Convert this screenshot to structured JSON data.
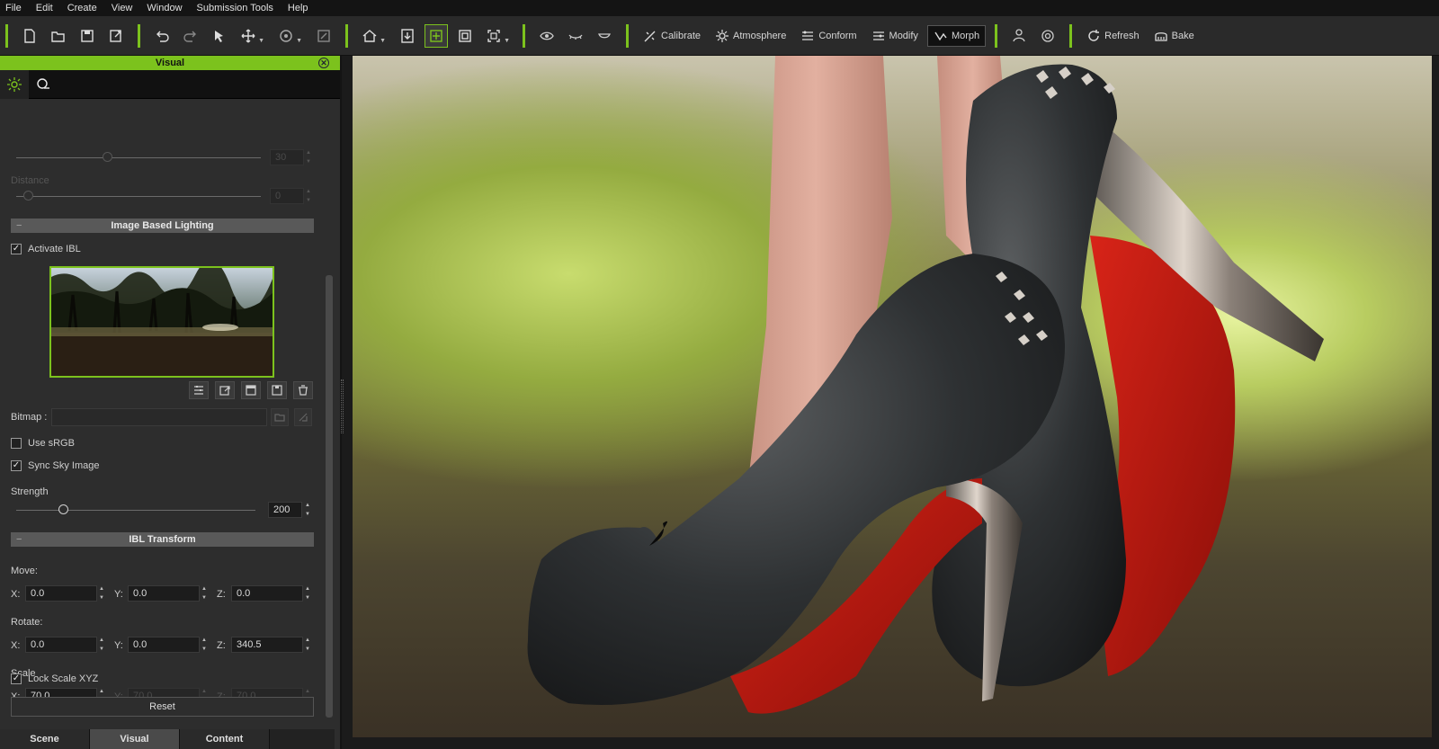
{
  "menu": [
    "File",
    "Edit",
    "Create",
    "View",
    "Window",
    "Submission Tools",
    "Help"
  ],
  "toolbar": {
    "calibrate": "Calibrate",
    "atmosphere": "Atmosphere",
    "conform": "Conform",
    "modify": "Modify",
    "morph": "Morph",
    "refresh": "Refresh",
    "bake": "Bake"
  },
  "panel": {
    "title": "Visual",
    "prev_value": "30",
    "distance_label": "Distance",
    "distance_value": "0",
    "ibl_section": "Image Based Lighting",
    "activate_ibl": "Activate IBL",
    "bitmap_label": "Bitmap :",
    "bitmap_value": "",
    "use_srgb": "Use sRGB",
    "sync_sky": "Sync Sky Image",
    "strength_label": "Strength",
    "strength_value": "200",
    "strength_level": 0.2,
    "transform_section": "IBL Transform",
    "move_label": "Move:",
    "rotate_label": "Rotate:",
    "scale_label": "Scale",
    "axis_x": "X:",
    "axis_y": "Y:",
    "axis_z": "Z:",
    "move": {
      "x": "0.0",
      "y": "0.0",
      "z": "0.0"
    },
    "rotate": {
      "x": "0.0",
      "y": "0.0",
      "z": "340.5"
    },
    "scale": {
      "x": "70.0",
      "y": "70.0",
      "z": "70.0"
    },
    "lock_scale": "Lock Scale XYZ",
    "reset": "Reset"
  },
  "bottom_tabs": [
    "Scene",
    "Visual",
    "Content"
  ],
  "colors": {
    "accent": "#7cc21d",
    "shoe_sole": "#b8180f",
    "shoe_leather": "#2a2c2e"
  }
}
